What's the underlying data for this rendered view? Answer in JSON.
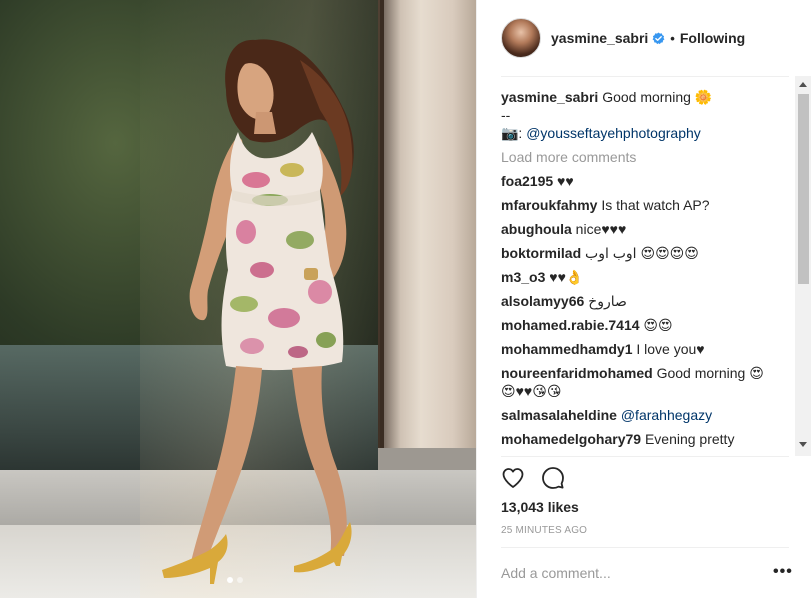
{
  "post": {
    "carousel": {
      "count": 2,
      "active_index": 0
    }
  },
  "header": {
    "username": "yasmine_sabri",
    "separator": "•",
    "follow_label": "Following"
  },
  "caption": {
    "username": "yasmine_sabri",
    "text": "Good morning 🌼",
    "line2": "--",
    "credit_prefix": "📷:",
    "credit_mention": "@yousseftayehphotography"
  },
  "load_more_label": "Load more comments",
  "comments": [
    {
      "user": "foa2195",
      "text": "♥♥"
    },
    {
      "user": "mfaroukfahmy",
      "text": "Is that watch AP?"
    },
    {
      "user": "abughoula",
      "text": "nice♥♥♥"
    },
    {
      "user": "boktormilad",
      "text": "اوب اوب 😍😍😍😍"
    },
    {
      "user": "m3_o3",
      "text": "♥♥👌"
    },
    {
      "user": "alsolamyy66",
      "text": "صاروخ"
    },
    {
      "user": "mohamed.rabie.7414",
      "text": "😍😍"
    },
    {
      "user": "mohammedhamdy1",
      "text": "I love you♥"
    },
    {
      "user": "noureenfaridmohamed",
      "text": "Good morning 😍",
      "text2": "😍♥♥😘😘"
    },
    {
      "user": "salmasalaheldine",
      "mention": "@farahhegazy"
    },
    {
      "user": "mohamedelgohary79",
      "text": "Evening pretty"
    }
  ],
  "likes_label": "13,043 likes",
  "timestamp": "25 MINUTES AGO",
  "add_comment_placeholder": "Add a comment...",
  "more_label": "•••",
  "icons": {
    "verified": "verified-badge-icon",
    "like": "heart-icon",
    "comment": "comment-bubble-icon",
    "more": "more-options-icon"
  },
  "colors": {
    "text": "#262626",
    "muted": "#999999",
    "link": "#003569",
    "verified": "#3897f0",
    "divider": "#efefef"
  }
}
